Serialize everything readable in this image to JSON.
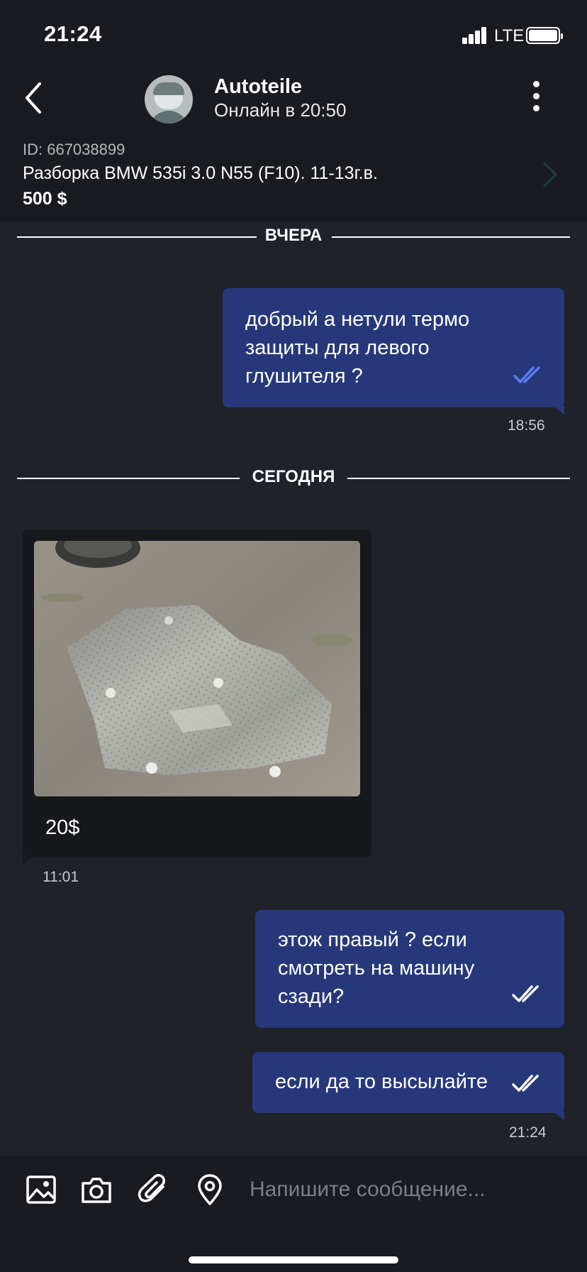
{
  "status_bar": {
    "time": "21:24",
    "network": "LTE"
  },
  "header": {
    "contact_name": "Autoteile",
    "contact_status": "Онлайн в 20:50"
  },
  "listing": {
    "id": "ID: 667038899",
    "title": "Разборка BMW 535i 3.0 N55 (F10). 11-13г.в.",
    "price": "500 $"
  },
  "separators": {
    "yesterday": "ВЧЕРА",
    "today": "СЕГОДНЯ"
  },
  "messages": {
    "m1": {
      "text": "добрый а нетули термо защиты для левого глушителя ?",
      "time": "18:56",
      "status": "read"
    },
    "m2": {
      "caption": "20$",
      "time": "11:01"
    },
    "m3": {
      "text": "этож правый ? если смотреть на машину сзади?",
      "status": "read"
    },
    "m4": {
      "text": "если да то высылайте",
      "time": "21:24",
      "status": "read"
    }
  },
  "composer": {
    "placeholder": "Напишите сообщение...",
    "tools": [
      "gallery-icon",
      "camera-icon",
      "paperclip-icon",
      "location-icon"
    ]
  },
  "colors": {
    "background": "#20222a",
    "header_background": "#191b20",
    "outgoing_bubble": "#27387a",
    "incoming_bubble": "#16181c",
    "read_ticks_accent": "#5b7cf0"
  }
}
